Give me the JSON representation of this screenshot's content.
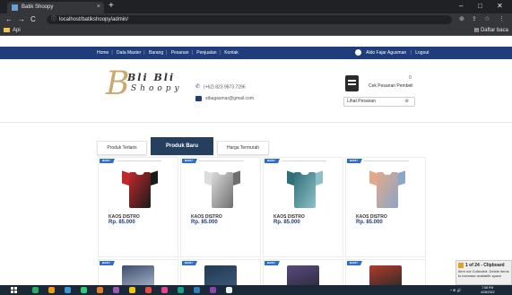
{
  "browser": {
    "tab_title": "Batik Shoopy",
    "tab_close": "×",
    "new_tab": "+",
    "url": "localhost/batikshoopy/admin/",
    "url_icon": "ⓘ",
    "bookmark_folder": "Api",
    "bookmark_right": "Daftar baca",
    "window_minimize": "–",
    "window_maximize": "□",
    "window_close": "✕"
  },
  "sitenav": {
    "items": [
      "Home",
      "Data Master",
      "Barang",
      "Pesanan",
      "Penjualan",
      "Kontak"
    ],
    "separator": "|",
    "user": "Aldo Fajar Agusman",
    "logout": "Logout"
  },
  "header": {
    "logo_mark": "B",
    "logo_name": "Bli Bli",
    "logo_sub": "Shoopy",
    "phone": "(+62) 823 9873 7296",
    "email": "stbagasmar@gmail.com",
    "cart_count": "0",
    "cart_label": "Cek Pesanan Pembeli",
    "cart_select_text": "Lihat Pesanan",
    "cart_select_icon": "⚙"
  },
  "tabs": [
    {
      "label": "Produk Terlaris",
      "active": false
    },
    {
      "label": "Produk Baru",
      "active": true
    },
    {
      "label": "Harga Termurah",
      "active": false
    }
  ],
  "products": [
    {
      "badge": "BARU",
      "name": "KAOS DISTRO",
      "price": "Rp. 85.000",
      "colors": [
        "#c0282c",
        "#1a1a1a"
      ]
    },
    {
      "badge": "BARU",
      "name": "KAOS DISTRO",
      "price": "Rp. 85.000",
      "colors": [
        "#dcdcdc",
        "#6e6e6e"
      ]
    },
    {
      "badge": "BARU",
      "name": "KAOS DISTRO",
      "price": "Rp. 85.000",
      "colors": [
        "#2f6f7a",
        "#8fc0c6"
      ]
    },
    {
      "badge": "BARU",
      "name": "KAOS DISTRO",
      "price": "Rp. 85.000",
      "colors": [
        "#e2a98a",
        "#8aa6c8"
      ]
    }
  ],
  "products_row2": [
    {
      "badge": "BARU",
      "colors": [
        "#3d4f6e",
        "#a8b4c8"
      ]
    },
    {
      "badge": "BARU",
      "colors": [
        "#233a52",
        "#3a5a7a"
      ]
    },
    {
      "badge": "BARU",
      "colors": [
        "#5a4a7a",
        "#2b2b40"
      ]
    },
    {
      "badge": "BARU",
      "colors": [
        "#b33a2a",
        "#2a2a2a"
      ]
    }
  ],
  "notification": {
    "title": "1 of 24 - Clipboard",
    "body": "Item not Collected: Delete items to increase available space"
  },
  "taskbar": {
    "tray": "^ ⊕ 🔊",
    "time": "7:58 PM",
    "date": "4/28/2022",
    "app_colors": [
      "#27ae60",
      "#f39c12",
      "#3498db",
      "#2ecc71",
      "#e67e22",
      "#9b59b6",
      "#f1c40f",
      "#e74c3c",
      "#e84393",
      "#16a085",
      "#2980b9",
      "#8e44ad",
      "#ecf0f1"
    ]
  },
  "colors": {
    "navbar": "#1f3d7a",
    "active_tab": "#253f5e",
    "badge": "#2e6fce",
    "price": "#1f3d7a"
  }
}
